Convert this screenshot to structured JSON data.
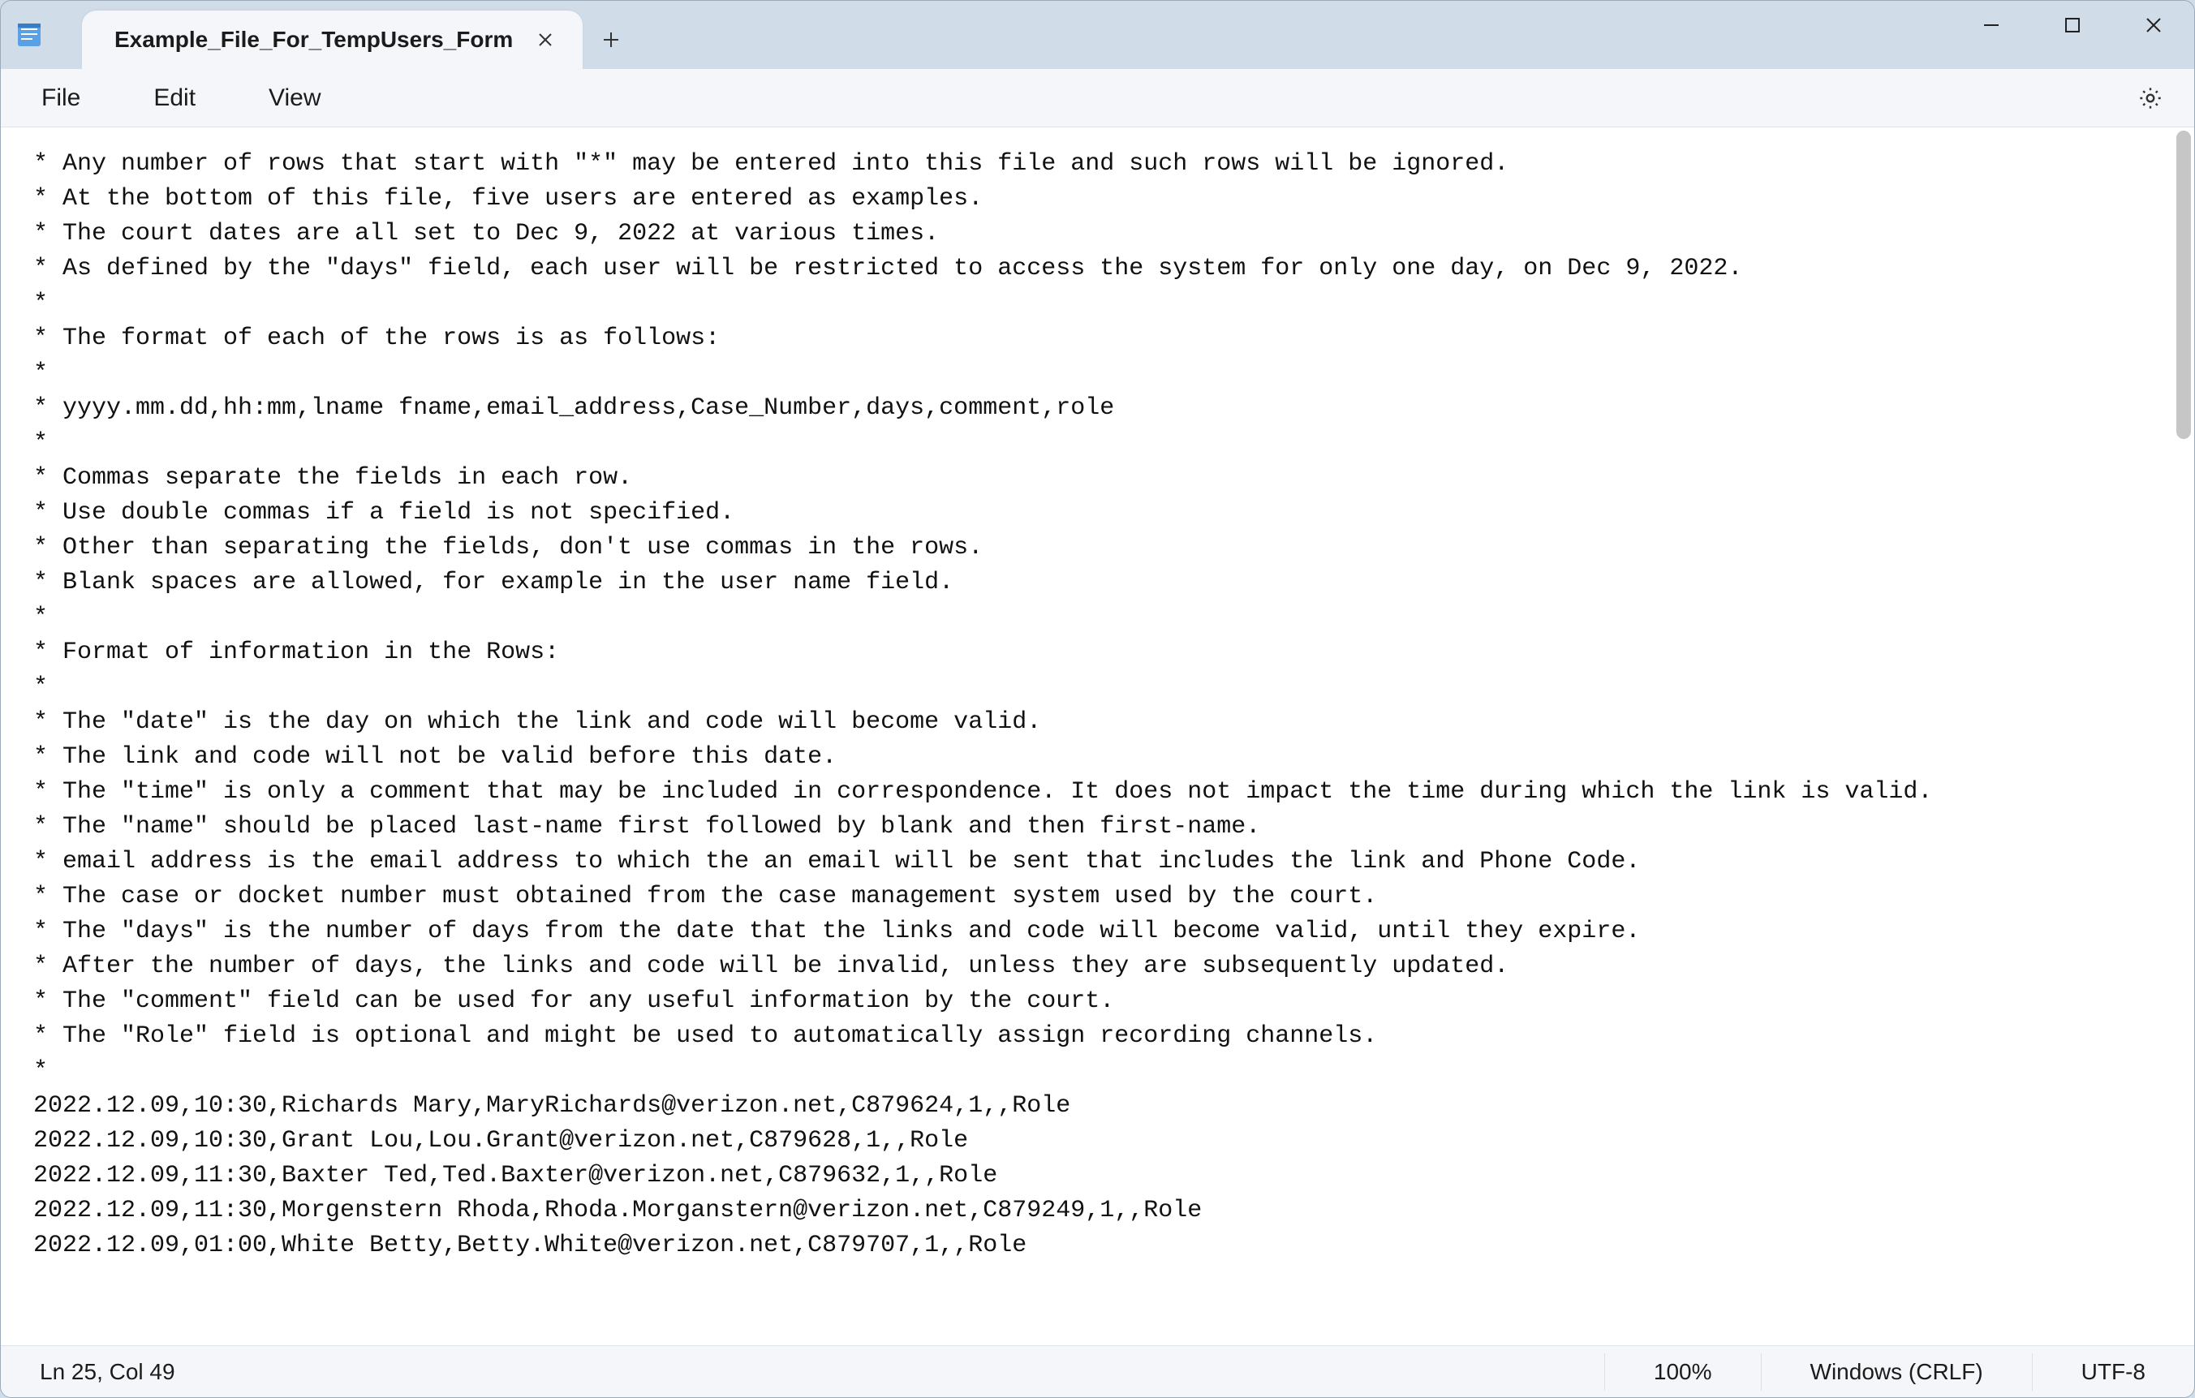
{
  "tab": {
    "title": "Example_File_For_TempUsers_Form"
  },
  "menu": {
    "file": "File",
    "edit": "Edit",
    "view": "View"
  },
  "status": {
    "cursor": "Ln 25, Col 49",
    "zoom": "100%",
    "line_ending": "Windows (CRLF)",
    "encoding": "UTF-8"
  },
  "document": {
    "lines": [
      "* Any number of rows that start with \"*\" may be entered into this file and such rows will be ignored.",
      "* At the bottom of this file, five users are entered as examples.",
      "* The court dates are all set to Dec 9, 2022 at various times.",
      "* As defined by the \"days\" field, each user will be restricted to access the system for only one day, on Dec 9, 2022.",
      "*",
      "* The format of each of the rows is as follows:",
      "*",
      "* yyyy.mm.dd,hh:mm,lname fname,email_address,Case_Number,days,comment,role",
      "*",
      "* Commas separate the fields in each row.",
      "* Use double commas if a field is not specified.",
      "* Other than separating the fields, don't use commas in the rows.",
      "* Blank spaces are allowed, for example in the user name field.",
      "*",
      "* Format of information in the Rows:",
      "*",
      "* The \"date\" is the day on which the link and code will become valid.",
      "* The link and code will not be valid before this date.",
      "* The \"time\" is only a comment that may be included in correspondence. It does not impact the time during which the link is valid.",
      "* The \"name\" should be placed last-name first followed by blank and then first-name.",
      "* email address is the email address to which the an email will be sent that includes the link and Phone Code.",
      "* The case or docket number must obtained from the case management system used by the court.",
      "* The \"days\" is the number of days from the date that the links and code will become valid, until they expire.",
      "* After the number of days, the links and code will be invalid, unless they are subsequently updated.",
      "* The \"comment\" field can be used for any useful information by the court.",
      "* The \"Role\" field is optional and might be used to automatically assign recording channels.",
      "*",
      "2022.12.09,10:30,Richards Mary,MaryRichards@verizon.net,C879624,1,,Role",
      "2022.12.09,10:30,Grant Lou,Lou.Grant@verizon.net,C879628,1,,Role",
      "2022.12.09,11:30,Baxter Ted,Ted.Baxter@verizon.net,C879632,1,,Role",
      "2022.12.09,11:30,Morgenstern Rhoda,Rhoda.Morganstern@verizon.net,C879249,1,,Role",
      "2022.12.09,01:00,White Betty,Betty.White@verizon.net,C879707,1,,Role"
    ]
  }
}
